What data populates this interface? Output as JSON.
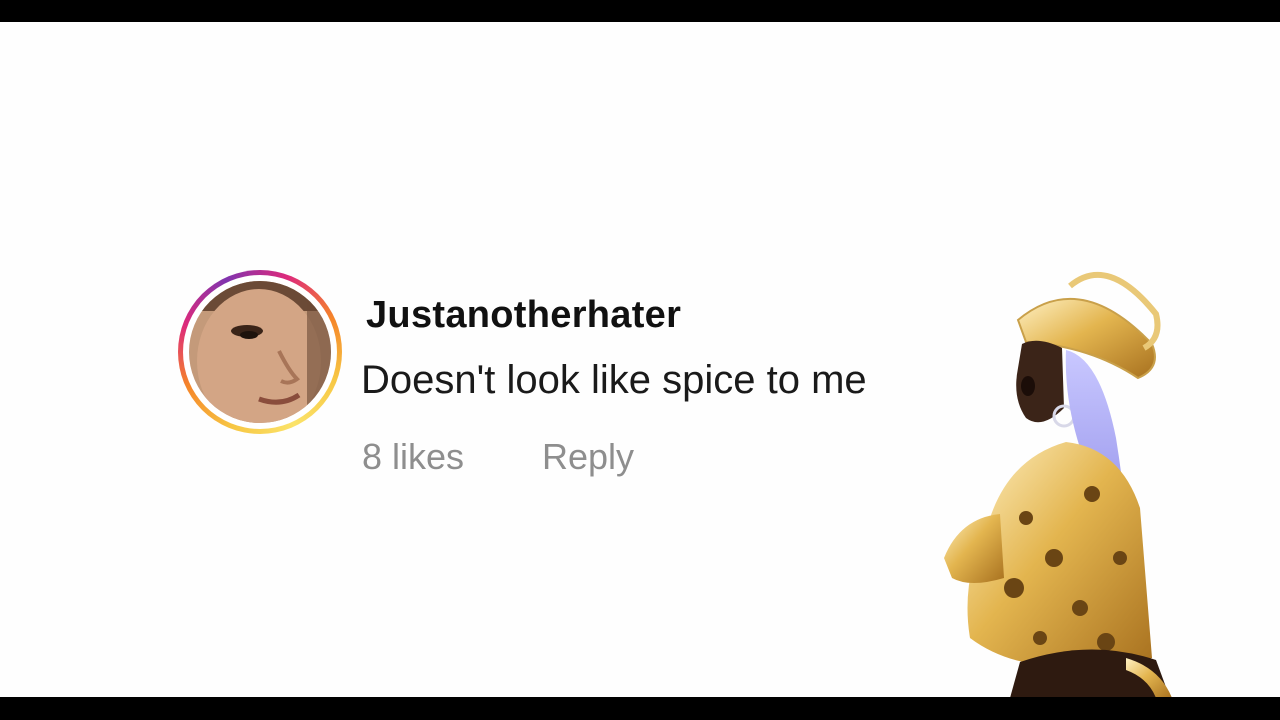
{
  "comment": {
    "username": "Justanotherhater",
    "text": "Doesn't look like spice to me",
    "likes": "8 likes",
    "reply_label": "Reply",
    "avatar_ring_colors": [
      "#f7c744",
      "#f58529",
      "#dd2a7b",
      "#8134af"
    ]
  },
  "icons": {
    "avatar": "user-avatar-photo",
    "overlay": "performer-cutout-image"
  },
  "colors": {
    "background": "#fefefe",
    "letterbox": "#000000",
    "username": "#111111",
    "secondary_text": "#8e8e8e"
  }
}
